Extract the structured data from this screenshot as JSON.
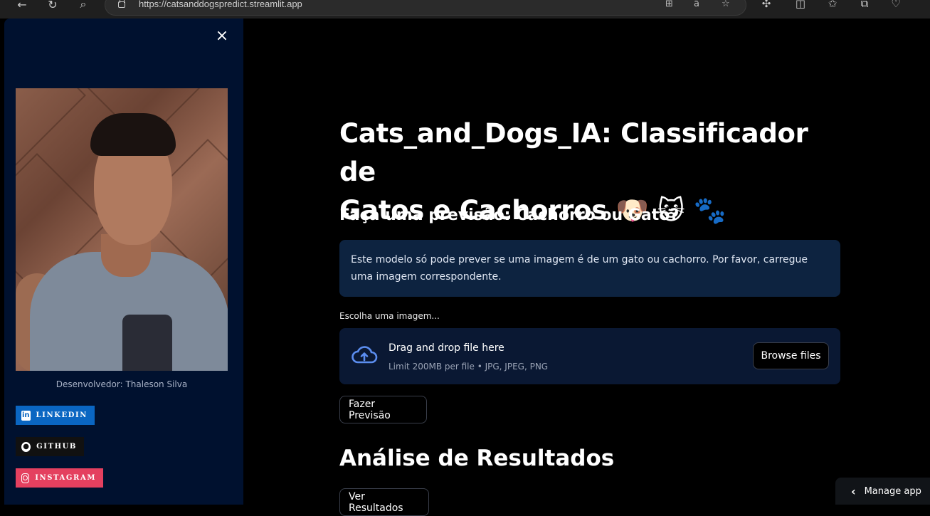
{
  "browser": {
    "url": "https://catsanddogspredict.streamlit.app",
    "icons": [
      "back-icon",
      "refresh-icon",
      "search-icon",
      "lock-icon",
      "apps-icon",
      "translate-icon",
      "favorite-star-icon",
      "extensions-icon",
      "split-screen-icon",
      "favorites-icon",
      "collections-icon",
      "browser-essentials-icon"
    ]
  },
  "sidebar": {
    "close_icon": "×",
    "developer_label": "Desenvolvedor: Thaleson Silva",
    "links": [
      {
        "label": "LINKEDIN",
        "icon": "linkedin-icon",
        "color": "#0a66c2"
      },
      {
        "label": "GITHUB",
        "icon": "github-icon",
        "color": "#111111"
      },
      {
        "label": "INSTAGRAM",
        "icon": "instagram-icon",
        "color": "#e4405f"
      }
    ]
  },
  "main": {
    "title_line1": "Cats_and_Dogs_IA: Classificador de",
    "title_line2": "Gatos e Cachorros 🐶 😺 🐾",
    "subtitle": "Faça uma previsão: Cachorro ou Gato?",
    "info": "Este modelo só pode prever se uma imagem é de um gato ou cachorro. Por favor, carregue uma imagem correspondente.",
    "uploader": {
      "label": "Escolha uma imagem...",
      "title": "Drag and drop file here",
      "limit": "Limit 200MB per file • JPG, JPEG, PNG",
      "browse_label": "Browse files"
    },
    "predict_button": "Fazer Previsão",
    "results_title": "Análise de Resultados",
    "results_button": "Ver Resultados"
  },
  "manage_app": "Manage app",
  "colors": {
    "sidebar_bg": "#00112f",
    "main_bg": "#000000",
    "info_bg": "#0d2340",
    "dropzone_bg": "#0a1833",
    "cloud_icon": "#5b8def"
  }
}
